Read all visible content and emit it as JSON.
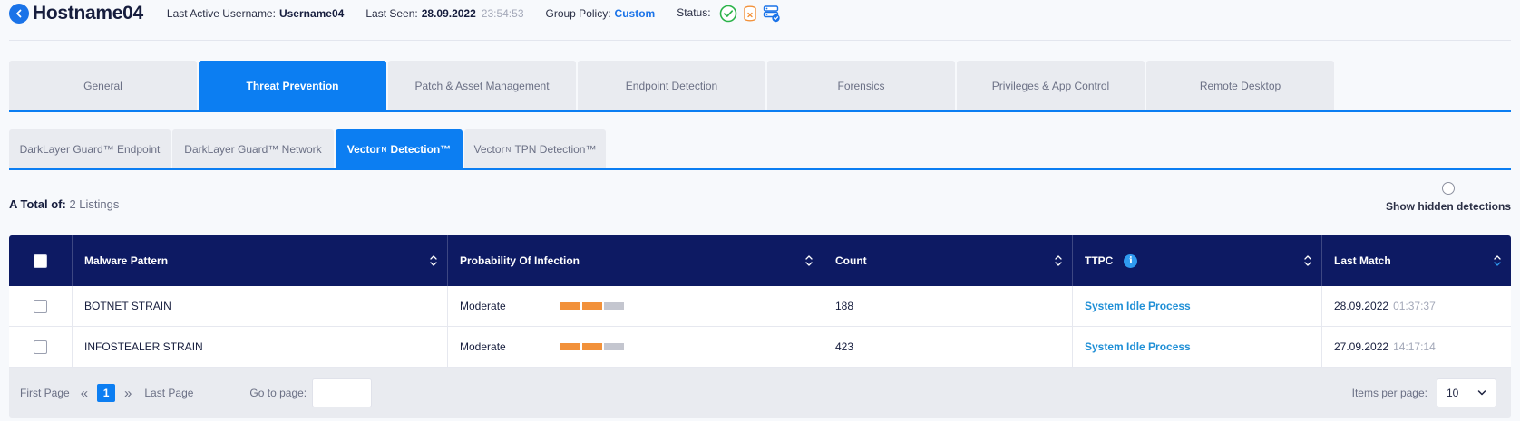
{
  "header": {
    "hostname": "Hostname04",
    "last_active_label": "Last Active Username:",
    "last_active_value": "Username04",
    "last_seen_label": "Last Seen:",
    "last_seen_date": "28.09.2022",
    "last_seen_time": "23:54:53",
    "group_policy_label": "Group Policy:",
    "group_policy_value": "Custom",
    "status_label": "Status:",
    "status_icons": [
      "check-circle-icon",
      "database-warning-icon",
      "server-check-icon"
    ]
  },
  "main_tabs": [
    {
      "label": "General"
    },
    {
      "label": "Threat Prevention",
      "active": true
    },
    {
      "label": "Patch & Asset Management"
    },
    {
      "label": "Endpoint Detection"
    },
    {
      "label": "Forensics"
    },
    {
      "label": "Privileges & App Control"
    },
    {
      "label": "Remote Desktop"
    }
  ],
  "sub_tabs": [
    {
      "label": "DarkLayer Guard™ Endpoint"
    },
    {
      "label": "DarkLayer Guard™ Network"
    },
    {
      "label_prefix": "Vector",
      "label_sup": "N",
      "label_suffix": " Detection™",
      "active": true
    },
    {
      "label_prefix": "Vector",
      "label_sup": "N",
      "label_suffix": " TPN Detection™"
    }
  ],
  "summary": {
    "total_label": "A Total of:",
    "total_value": "2 Listings",
    "hidden_toggle_label": "Show hidden detections"
  },
  "table": {
    "columns": [
      "Malware Pattern",
      "Probability Of Infection",
      "Count",
      "TTPC",
      "Last Match"
    ],
    "rows": [
      {
        "pattern": "BOTNET STRAIN",
        "probability": "Moderate",
        "probability_level": 2,
        "probability_max": 3,
        "count": "188",
        "ttpc": "System Idle Process",
        "date": "28.09.2022",
        "time": "01:37:37"
      },
      {
        "pattern": "INFOSTEALER STRAIN",
        "probability": "Moderate",
        "probability_level": 2,
        "probability_max": 3,
        "count": "423",
        "ttpc": "System Idle Process",
        "date": "27.09.2022",
        "time": "14:17:14"
      }
    ]
  },
  "pagination": {
    "first_label": "First Page",
    "current_page": "1",
    "last_label": "Last Page",
    "goto_label": "Go to page:",
    "goto_value": "",
    "items_per_page_label": "Items per page:",
    "items_per_page_value": "10"
  },
  "colors": {
    "accent": "#0c7ef2",
    "table_header": "#0d1a63",
    "probability_on": "#f2913a",
    "probability_off": "#c4c6cf",
    "link": "#1f8fd6"
  }
}
